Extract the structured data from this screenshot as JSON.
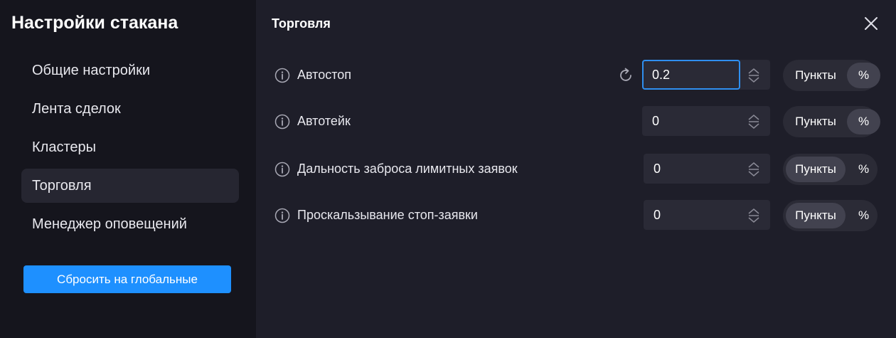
{
  "sidebar": {
    "title": "Настройки стакана",
    "items": [
      {
        "label": "Общие настройки"
      },
      {
        "label": "Лента сделок"
      },
      {
        "label": "Кластеры"
      },
      {
        "label": "Торговля"
      },
      {
        "label": "Менеджер оповещений"
      }
    ],
    "active_index": 3,
    "reset_label": "Сбросить на глобальные"
  },
  "main": {
    "title": "Торговля",
    "rows": [
      {
        "label": "Автостоп",
        "value": "0.2",
        "unit_options": [
          "Пункты",
          "%"
        ],
        "selected": "%"
      },
      {
        "label": "Автотейк",
        "value": "0",
        "unit_options": [
          "Пункты",
          "%"
        ],
        "selected": "%"
      },
      {
        "label": "Дальность заброса лимитных заявок",
        "value": "0",
        "unit_options": [
          "Пункты",
          "%"
        ],
        "selected": "Пункты"
      },
      {
        "label": "Проскальзывание стоп-заявки",
        "value": "0",
        "unit_options": [
          "Пункты",
          "%"
        ],
        "selected": "Пункты"
      }
    ]
  },
  "icons": {
    "close": "close-icon",
    "info": "info-icon",
    "refresh": "refresh-icon",
    "stepper": "stepper-icon"
  },
  "colors": {
    "accent": "#1e90ff",
    "sidebar_bg": "#15151d",
    "main_bg": "#1e1e29",
    "input_bg": "#2a2a36",
    "focus_border": "#2f8ff0"
  }
}
